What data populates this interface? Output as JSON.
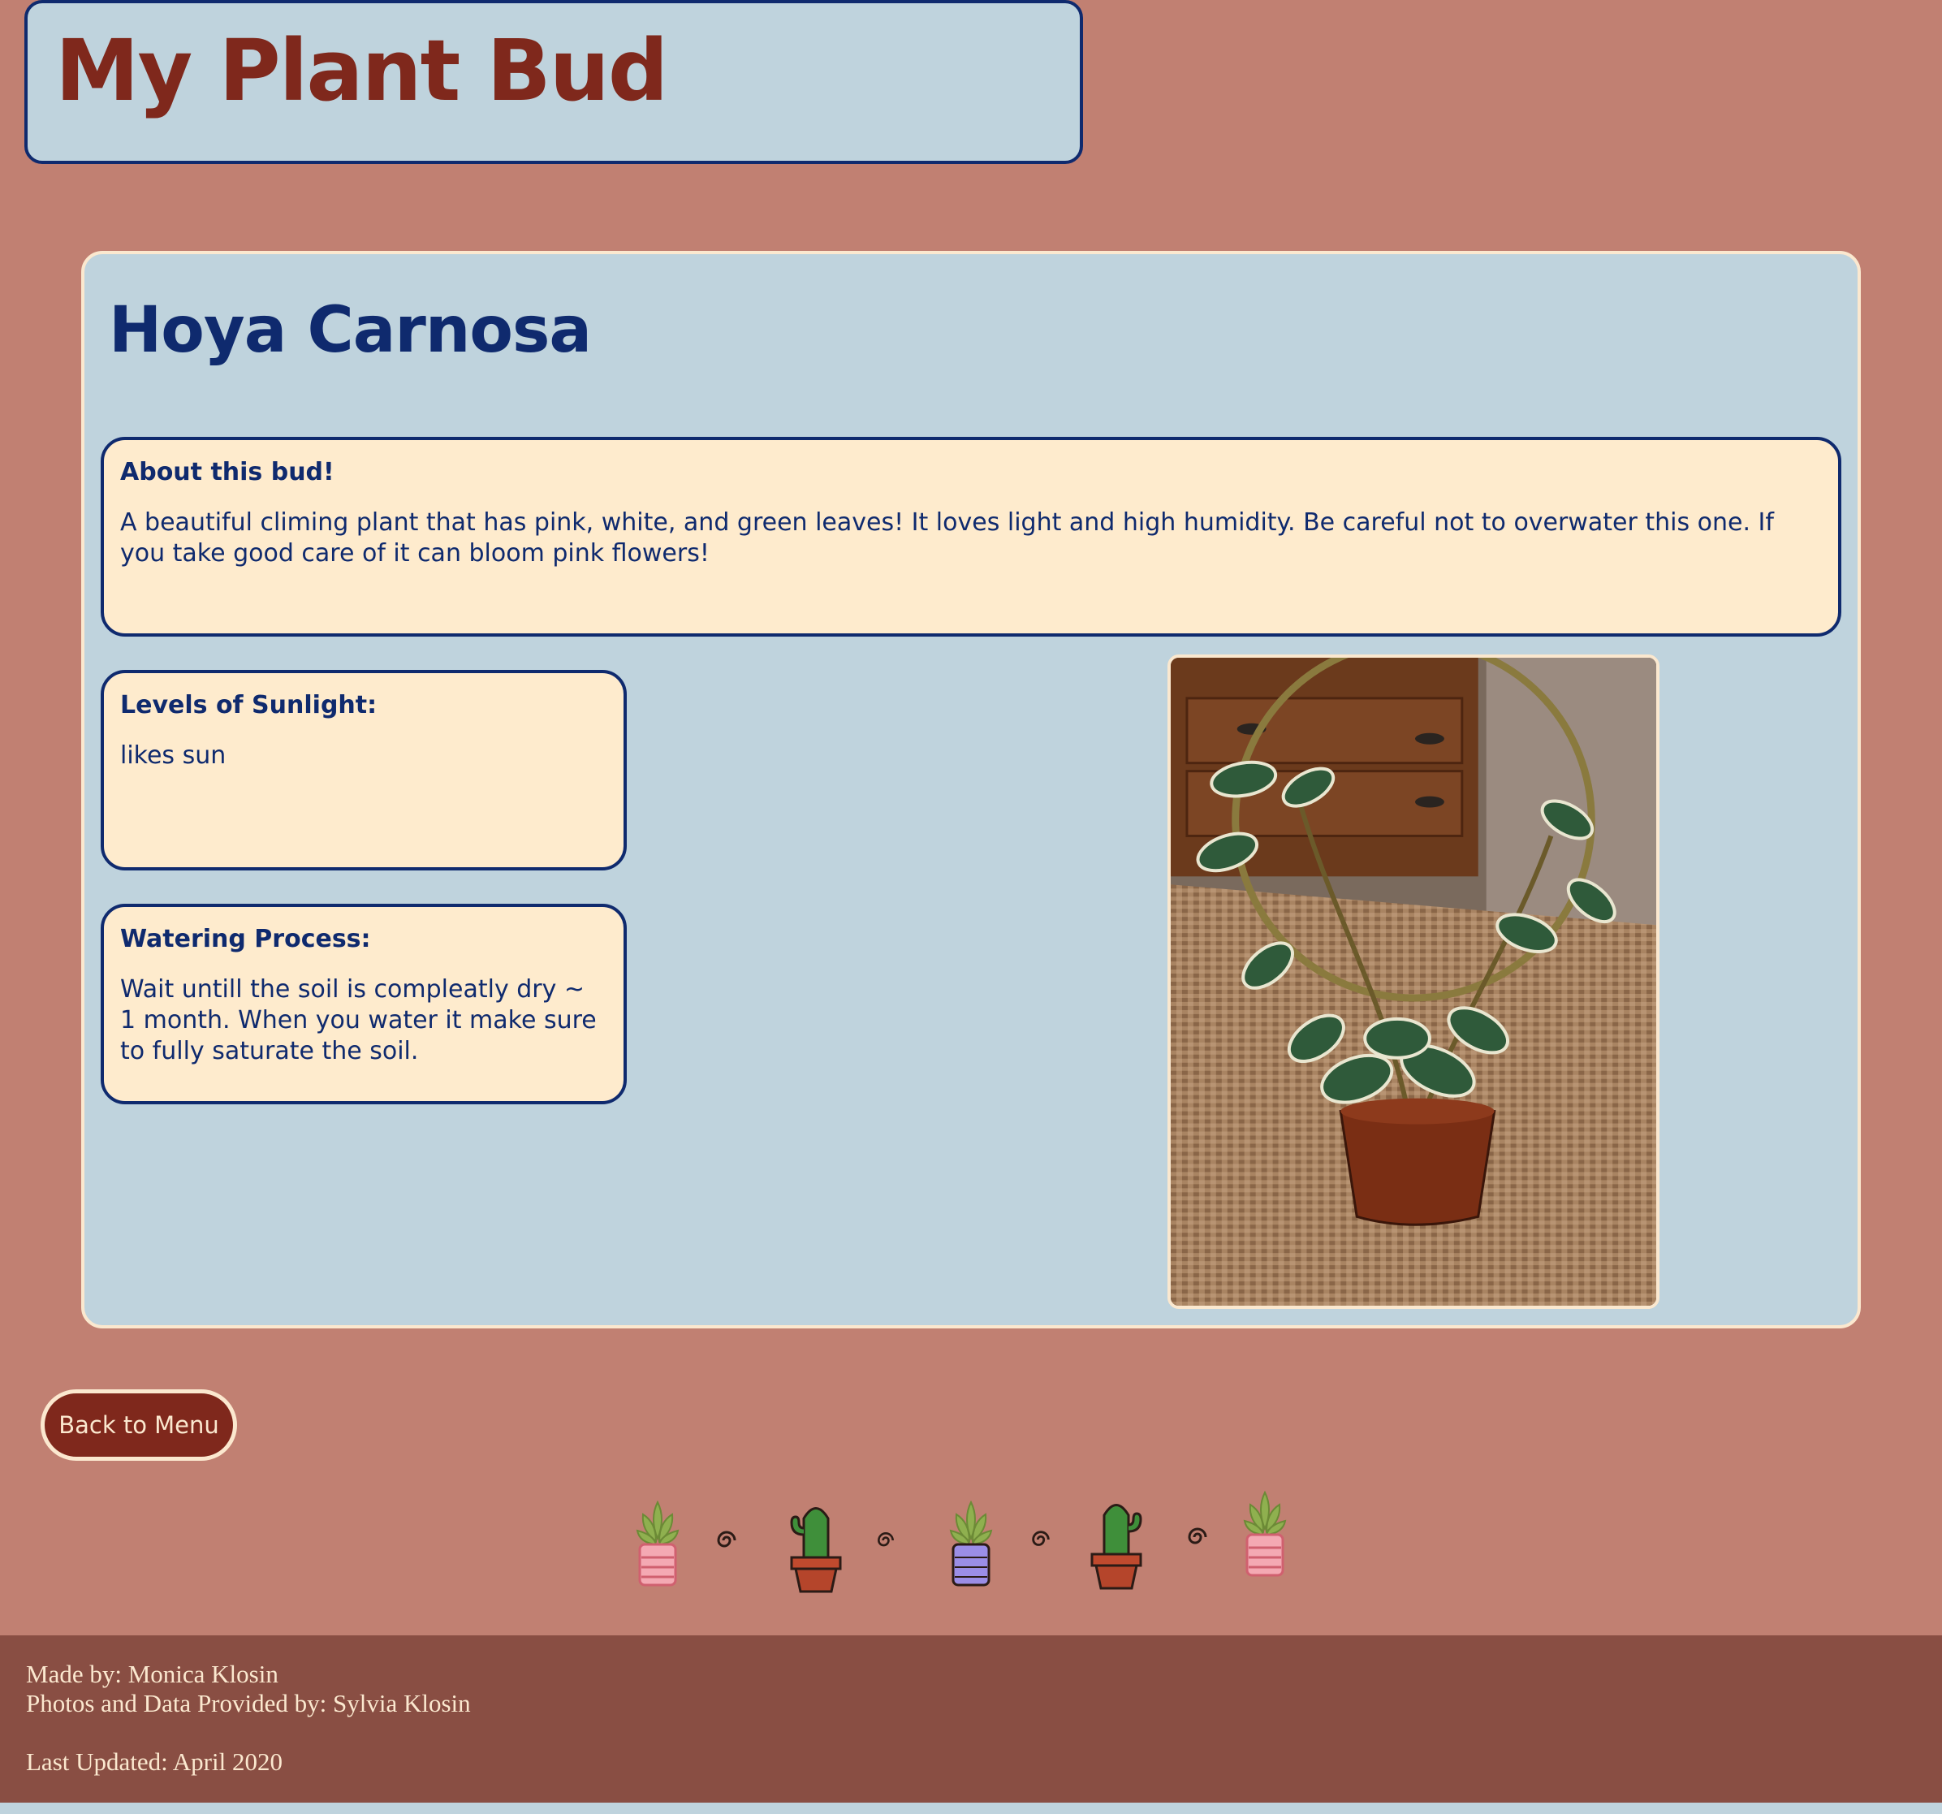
{
  "header": {
    "title": "My Plant Bud"
  },
  "plant": {
    "name": "Hoya Carnosa",
    "about": {
      "heading": "About this bud!",
      "text": "A beautiful climing plant that has pink, white, and green leaves! It loves light and high humidity. Be careful not to overwater this one. If you take good care of it can bloom pink flowers!"
    },
    "sunlight": {
      "heading": "Levels of Sunlight:",
      "text": "likes sun"
    },
    "watering": {
      "heading": "Watering Process:",
      "text": "Wait untill the soil is compleatly dry ~ 1 month. When you water it make sure to fully saturate the soil."
    }
  },
  "nav": {
    "back_label": "Back to Menu"
  },
  "footer": {
    "made_by": "Made by: Monica Klosin",
    "credits": "Photos and Data Provided by: Sylvia Klosin",
    "updated": "Last Updated: April 2020"
  },
  "colors": {
    "page_bg": "#c18072",
    "card_bg": "#bfd3dd",
    "box_bg": "#feebcd",
    "navy": "#0f2a6e",
    "brick": "#7f281c",
    "footer_bg": "#894e43"
  },
  "icons": [
    "succulent-pink-pot-icon",
    "swirl-icon",
    "cactus-pot-icon",
    "swirl-icon",
    "succulent-purple-pot-icon",
    "swirl-icon",
    "cactus-pot-icon",
    "swirl-icon",
    "succulent-pink-pot-icon"
  ]
}
